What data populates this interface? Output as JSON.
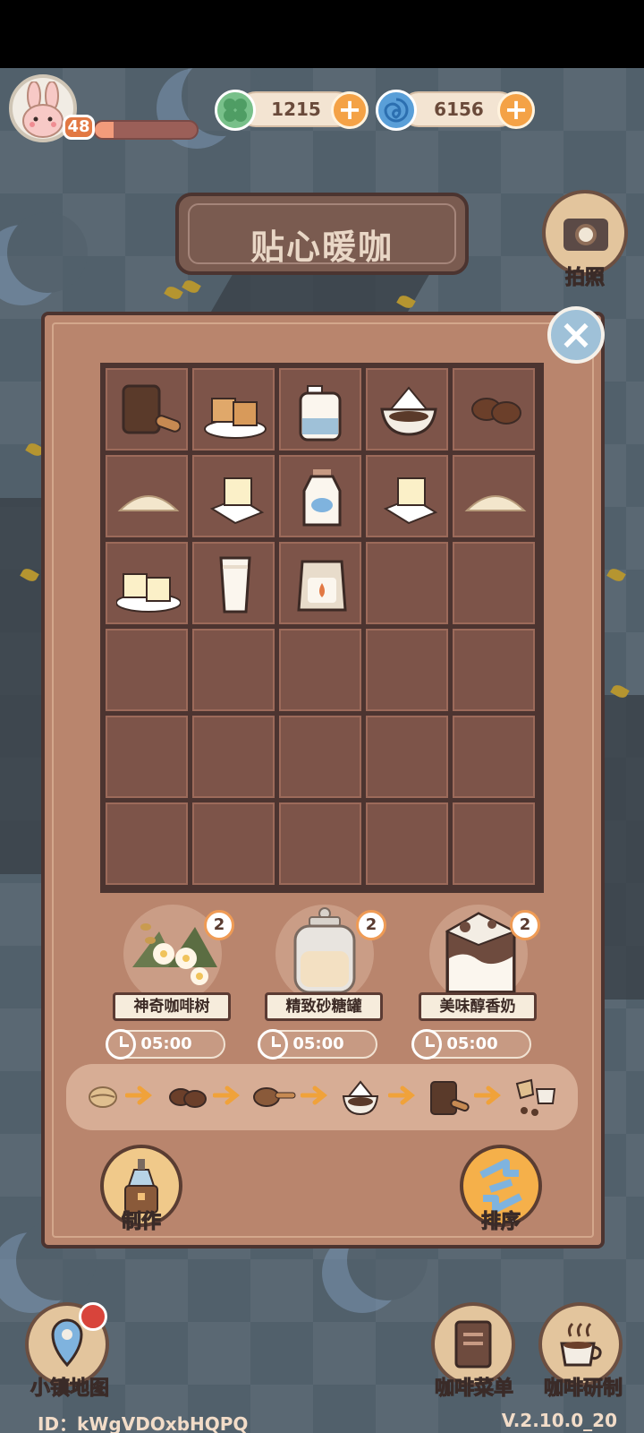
{
  "hud": {
    "level": "48",
    "xp_progress": 0.18,
    "currency_leaf": "1215",
    "currency_swirl": "6156",
    "plus_label": "+",
    "leaf_icon": "clover-icon",
    "swirl_icon": "swirl-icon"
  },
  "title": "贴心暖咖",
  "camera": {
    "label": "拍照",
    "icon": "camera-icon"
  },
  "panel": {
    "close_label": "×",
    "inventory": [
      "coffee-grounds-pot",
      "brown-sugar-cubes",
      "milk-jug",
      "coffee-dripper",
      "coffee-beans",
      "sugar-powder",
      "butter-block",
      "milk-bottle",
      "butter-block",
      "sugar-powder",
      "sugar-cubes-plate",
      "glass-of-milk",
      "milk-powder-bag",
      "",
      "",
      "",
      "",
      "",
      "",
      "",
      "",
      "",
      "",
      "",
      "",
      "",
      "",
      "",
      "",
      ""
    ],
    "producers": [
      {
        "name": "神奇咖啡树",
        "count": "2",
        "timer": "05:00",
        "icon": "coffee-tree-icon"
      },
      {
        "name": "精致砂糖罐",
        "count": "2",
        "timer": "05:00",
        "icon": "sugar-jar-icon"
      },
      {
        "name": "美味醇香奶",
        "count": "2",
        "timer": "05:00",
        "icon": "milk-carton-icon"
      }
    ],
    "chain": [
      "coffee-bean",
      "roasted-beans",
      "ground-coffee-spoon",
      "coffee-dripper",
      "coffee-grounds-pot",
      "espresso-cups"
    ],
    "make_label": "制作",
    "sort_label": "排序"
  },
  "bottom": {
    "map_label": "小镇地图",
    "menu_label": "咖啡菜单",
    "research_label": "咖啡研制",
    "id_text": "ID：kWgVDOxbHQPQ",
    "version": "V.2.10.0_20"
  },
  "colors": {
    "panel": "#b9856d",
    "cell": "#7d5449",
    "accent": "#f4a246",
    "leaf_currency": "#78c08a",
    "swirl_currency": "#5a9fd8"
  }
}
